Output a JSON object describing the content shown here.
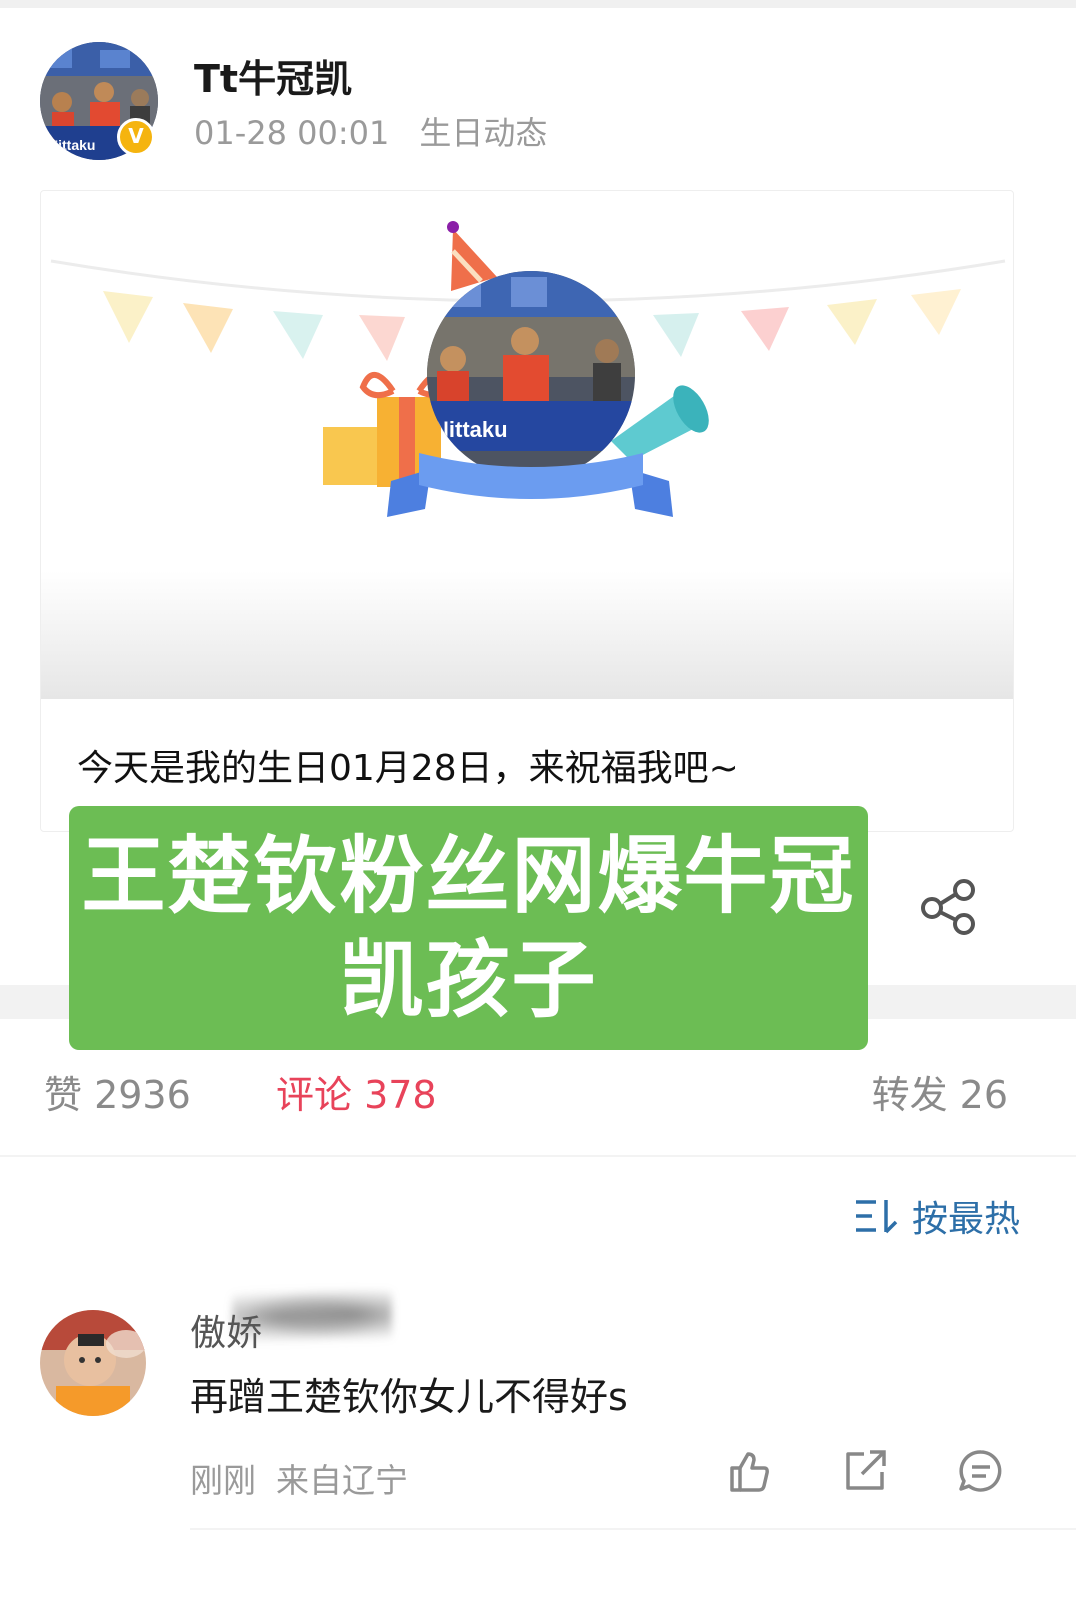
{
  "post": {
    "username": "Tt牛冠凯",
    "verify_mark": "V",
    "time": "01-28 00:01",
    "tag": "生日动态",
    "caption": "今天是我的生日01月28日，来祝福我吧~"
  },
  "overlay": {
    "text": "王楚钦粉丝网爆牛冠凯孩子"
  },
  "stats": {
    "likes": "赞 2936",
    "comments": "评论 378",
    "reposts": "转发 26"
  },
  "sort": {
    "label": "按最热"
  },
  "comment": {
    "username": "傲娇",
    "text": "再蹭王楚钦你女儿不得好s",
    "time": "刚刚",
    "location": "来自辽宁"
  },
  "colors": {
    "accent_red": "#e8435a",
    "link_blue": "#2d6fa8",
    "banner_green": "#6cbd54",
    "badge_gold": "#f5b40f"
  },
  "icons": [
    "verified-badge-icon",
    "share-icon",
    "sort-icon",
    "like-icon",
    "repost-icon",
    "comment-icon"
  ]
}
